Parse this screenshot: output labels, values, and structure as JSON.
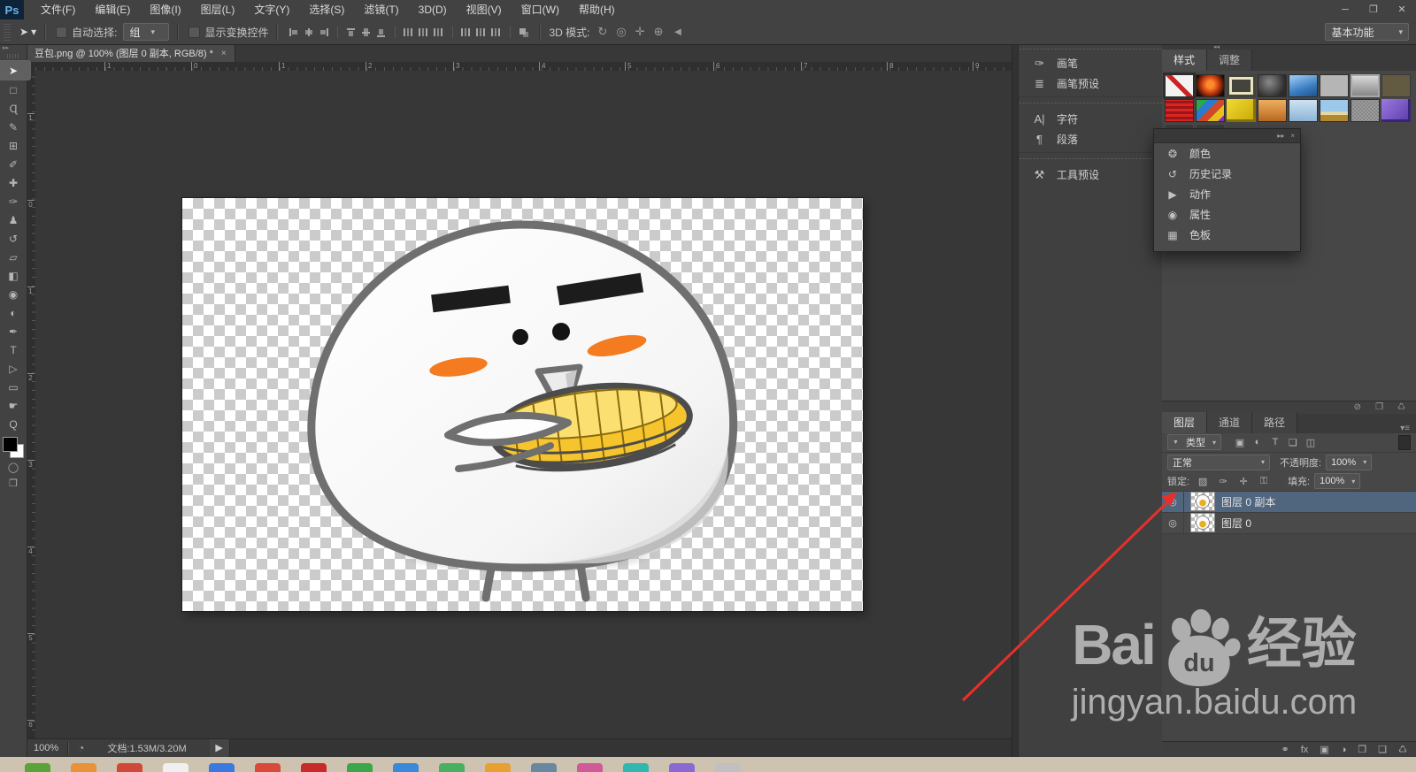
{
  "ui": {
    "caret": "▾",
    "collapse_right": "▸▸",
    "collapse_left": "◂◂",
    "panel_close": "×",
    "eye": "◎",
    "clock": "◔",
    "tab_menu": "▾≡"
  },
  "window": {
    "minimize": "─",
    "restore": "❐",
    "close": "✕"
  },
  "menubar": {
    "logo": "Ps",
    "items": [
      "文件(F)",
      "编辑(E)",
      "图像(I)",
      "图层(L)",
      "文字(Y)",
      "选择(S)",
      "滤镜(T)",
      "3D(D)",
      "视图(V)",
      "窗口(W)",
      "帮助(H)"
    ]
  },
  "optionsbar": {
    "tool_glyph": "➤",
    "auto_select_label": "自动选择:",
    "auto_select_value": "组",
    "show_transform_label": "显示变换控件",
    "align_icons": [
      {
        "n": "align-left-edges",
        "cls": "aln aln-l"
      },
      {
        "n": "align-horizontal-centers",
        "cls": "aln aln-cv"
      },
      {
        "n": "align-right-edges",
        "cls": "aln aln-r"
      },
      {
        "n": "align-top-edges",
        "cls": "aln aln-t gsp"
      },
      {
        "n": "align-vertical-centers",
        "cls": "aln aln-ch"
      },
      {
        "n": "align-bottom-edges",
        "cls": "aln aln-b"
      },
      {
        "n": "distribute-top-edges",
        "cls": "aln aln-d gsp"
      },
      {
        "n": "distribute-vertical-centers",
        "cls": "aln aln-d"
      },
      {
        "n": "distribute-bottom-edges",
        "cls": "aln aln-d"
      },
      {
        "n": "distribute-left-edges",
        "cls": "aln aln-d gsp"
      },
      {
        "n": "distribute-horizontal-centers",
        "cls": "aln aln-d"
      },
      {
        "n": "distribute-right-edges",
        "cls": "aln aln-d"
      },
      {
        "n": "auto-align-layers",
        "cls": "aln aln-x gsp"
      }
    ],
    "mode_label": "3D 模式:",
    "mode_icons": [
      {
        "g": "↻",
        "n": "3d-rotate-icon"
      },
      {
        "g": "◎",
        "n": "3d-roll-icon"
      },
      {
        "g": "✛",
        "n": "3d-drag-icon"
      },
      {
        "g": "⊕",
        "n": "3d-slide-icon"
      },
      {
        "g": "◄",
        "n": "3d-scale-icon"
      }
    ],
    "workspace": "基本功能"
  },
  "doc": {
    "tab_title": "豆包.png @ 100% (图层 0 副本, RGB/8) *",
    "close": "×",
    "ruler_h": [
      {
        "t": "1",
        "css": "left:78px"
      },
      {
        "t": "0",
        "css": "left:176px"
      },
      {
        "t": "1",
        "css": "left:275px"
      },
      {
        "t": "2",
        "css": "left:373px"
      },
      {
        "t": "3",
        "css": "left:472px"
      },
      {
        "t": "4",
        "css": "left:569px"
      },
      {
        "t": "5",
        "css": "left:666px"
      },
      {
        "t": "6",
        "css": "left:766px"
      },
      {
        "t": "7",
        "css": "left:865px"
      },
      {
        "t": "8",
        "css": "left:962px"
      },
      {
        "t": "9",
        "css": "left:1059px"
      }
    ],
    "ruler_v": [
      {
        "t": "1",
        "css": "top:48px"
      },
      {
        "t": "0",
        "css": "top:146px"
      },
      {
        "t": "1",
        "css": "top:244px"
      },
      {
        "t": "2",
        "css": "top:342px"
      },
      {
        "t": "3",
        "css": "top:440px"
      },
      {
        "t": "4",
        "css": "top:538px"
      },
      {
        "t": "5",
        "css": "top:636px"
      },
      {
        "t": "6",
        "css": "top:734px"
      }
    ]
  },
  "tools": [
    {
      "g": "➤",
      "n": "move-tool",
      "cls": "tool sel"
    },
    {
      "g": "□",
      "n": "rectangular-marquee-tool",
      "cls": "tool"
    },
    {
      "g": "Ɋ",
      "n": "lasso-tool",
      "cls": "tool"
    },
    {
      "g": "✎",
      "n": "quick-selection-tool",
      "cls": "tool"
    },
    {
      "g": "⊞",
      "n": "crop-tool",
      "cls": "tool"
    },
    {
      "g": "✐",
      "n": "eyedropper-tool",
      "cls": "tool"
    },
    {
      "g": "✚",
      "n": "healing-brush-tool",
      "cls": "tool"
    },
    {
      "g": "✑",
      "n": "brush-tool",
      "cls": "tool"
    },
    {
      "g": "♟",
      "n": "clone-stamp-tool",
      "cls": "tool"
    },
    {
      "g": "↺",
      "n": "history-brush-tool",
      "cls": "tool"
    },
    {
      "g": "▱",
      "n": "eraser-tool",
      "cls": "tool"
    },
    {
      "g": "◧",
      "n": "gradient-tool",
      "cls": "tool"
    },
    {
      "g": "◉",
      "n": "blur-tool",
      "cls": "tool"
    },
    {
      "g": "◐",
      "n": "dodge-tool",
      "cls": "tool"
    },
    {
      "g": "✒",
      "n": "pen-tool",
      "cls": "tool"
    },
    {
      "g": "T",
      "n": "type-tool",
      "cls": "tool"
    },
    {
      "g": "▷",
      "n": "path-selection-tool",
      "cls": "tool"
    },
    {
      "g": "▭",
      "n": "rectangle-tool",
      "cls": "tool"
    },
    {
      "g": "☛",
      "n": "hand-tool",
      "cls": "tool"
    },
    {
      "g": "Ԛ",
      "n": "zoom-tool",
      "cls": "tool"
    }
  ],
  "dock": {
    "group1": [
      {
        "g": "✑",
        "label": "画笔"
      },
      {
        "g": "≣",
        "label": "画笔预设"
      }
    ],
    "group2": [
      {
        "g": "A|",
        "label": "字符"
      },
      {
        "g": "¶",
        "label": "段落"
      }
    ],
    "group3": [
      {
        "g": "⚒",
        "label": "工具预设"
      }
    ]
  },
  "floatpanel": {
    "items": [
      {
        "g": "❂",
        "label": "颜色"
      },
      {
        "g": "↺",
        "label": "历史记录"
      },
      {
        "g": "▶",
        "label": "动作"
      },
      {
        "g": "◉",
        "label": "属性"
      },
      {
        "g": "▦",
        "label": "色板"
      }
    ]
  },
  "styles_panel": {
    "tabs": [
      "样式",
      "调整"
    ],
    "swatches": [
      {
        "n": "style-none",
        "css": "background:linear-gradient(45deg,transparent 44%,#cc2222 44% 56%,transparent 56%),#f2f2f2;box-shadow:inset 0 0 0 1px #2d2d2d,0 0 0 2px #2e2e2e"
      },
      {
        "n": "style-orange-glow",
        "css": "background:radial-gradient(circle at 50% 45%,#ff8a2a 0 18%,#c63a10 45%,#1a0a06 78%)"
      },
      {
        "n": "style-cream-ring",
        "css": "background:#44443c;box-shadow:inset 0 0 0 3px #44443c,inset 0 0 0 6px #e9e4bd"
      },
      {
        "n": "style-dark-glass",
        "css": "background:radial-gradient(circle at 40% 35%,#8a8a8a,#2c2c2c 70%)"
      },
      {
        "n": "style-blue-gloss",
        "css": "background:linear-gradient(160deg,#8ec0ee 15%,#3a7cc0 60%,#1d4f86)"
      },
      {
        "n": "style-flat-gray",
        "css": "background:#b5b5b5"
      },
      {
        "n": "style-gray-bevel",
        "css": "background:linear-gradient(#e0e0e0,#7f7f7f);box-shadow:inset 0 0 0 2px #a8a8a8"
      },
      {
        "n": "style-olive",
        "css": "background:#7d6f3f;opacity:.5"
      },
      {
        "n": "style-red-stripes",
        "css": "background:repeating-linear-gradient(0deg,#d92626 0 3px,#9e1515 3px 6px)"
      },
      {
        "n": "style-multicolor",
        "css": "background:linear-gradient(135deg,#2aa84a 0 25%,#2a7ad0 25% 45%,#d04a2a 45% 65%,#e8c020 65% 85%,#8a2ad0 85%)"
      },
      {
        "n": "style-yellow-3d",
        "css": "background:linear-gradient(135deg,#f2da30,#c8a80a);box-shadow:inset -3px -3px 0 #8a7400"
      },
      {
        "n": "style-orange-gradient",
        "css": "background:linear-gradient(#f0b060,#b86820)"
      },
      {
        "n": "style-light-blue",
        "css": "background:linear-gradient(#cfe4f4,#8cb4d4)"
      },
      {
        "n": "style-landscape",
        "css": "background:linear-gradient(#9cc8ea 55%,#e8d8a0 55% 70%,#b08830 70%)"
      },
      {
        "n": "style-noise",
        "css": "background:repeating-conic-gradient(#9e9e9e 0 25%,#858585 0 50%) 0 0/4px 4px"
      },
      {
        "n": "style-purple-3d",
        "css": "background:linear-gradient(135deg,#9a7ae0,#5a3aa8);box-shadow:inset -3px -3px 0 #3a2478"
      },
      {
        "n": "style-empty-slot",
        "css": "background:#3d3d3d;box-shadow:inset 0 0 0 1px #4e4e4e"
      },
      {
        "n": "style-empty-slot",
        "css": "background:#3d3d3d;box-shadow:inset 0 0 0 1px #4e4e4e"
      }
    ],
    "footer_icons": [
      {
        "g": "⊘",
        "n": "clear-style-icon"
      },
      {
        "g": "❐",
        "n": "new-style-icon"
      },
      {
        "g": "♺",
        "n": "delete-style-icon"
      }
    ]
  },
  "layers_panel": {
    "tabs": [
      "图层",
      "通道",
      "路径"
    ],
    "filter_icon": "▼",
    "filter_value": "类型",
    "filter_icons": [
      {
        "g": "▣",
        "n": "filter-pixel-layers-icon"
      },
      {
        "g": "◐",
        "n": "filter-adjustment-layers-icon"
      },
      {
        "g": "T",
        "n": "filter-type-layers-icon"
      },
      {
        "g": "❏",
        "n": "filter-shape-layers-icon"
      },
      {
        "g": "◫",
        "n": "filter-smart-objects-icon"
      }
    ],
    "blend_mode": "正常",
    "opacity_label": "不透明度:",
    "opacity_value": "100%",
    "lock_label": "锁定:",
    "lock_icons": [
      {
        "g": "▨",
        "n": "lock-transparent-pixels-icon"
      },
      {
        "g": "✑",
        "n": "lock-image-pixels-icon"
      },
      {
        "g": "✛",
        "n": "lock-position-icon"
      },
      {
        "g": "⚿",
        "n": "lock-all-icon"
      }
    ],
    "fill_label": "填充:",
    "fill_value": "100%",
    "rows": [
      {
        "name": "图层 0 副本",
        "cls": "layer-row selected"
      },
      {
        "name": "图层 0",
        "cls": "layer-row"
      }
    ],
    "footer_icons": [
      {
        "g": "⚭",
        "n": "link-layers-icon"
      },
      {
        "g": "fx",
        "n": "layer-style-icon"
      },
      {
        "g": "▣",
        "n": "add-layer-mask-icon"
      },
      {
        "g": "◑",
        "n": "adjustment-layer-icon"
      },
      {
        "g": "❒",
        "n": "new-group-icon"
      },
      {
        "g": "❑",
        "n": "new-layer-icon"
      },
      {
        "g": "♺",
        "n": "delete-layer-icon"
      }
    ]
  },
  "statusbar": {
    "zoom": "100%",
    "doc_info": "文档:1.53M/3.20M",
    "arrow": "▶"
  },
  "watermark": {
    "bai": "Bai",
    "du": "du",
    "jingyan": "经验",
    "url": "jingyan.baidu.com"
  },
  "taskbar": {
    "icons": [
      {
        "css": "background:#5aa23a"
      },
      {
        "css": "background:#e8923a"
      },
      {
        "css": "background:#d04838"
      },
      {
        "css": "background:#f0f0f0"
      },
      {
        "css": "background:#3a7ade"
      },
      {
        "css": "background:#d94a3a"
      },
      {
        "css": "background:#c82a2a"
      },
      {
        "css": "background:#3aa84a"
      },
      {
        "css": "background:#3a88d8"
      },
      {
        "css": "background:#48b060"
      },
      {
        "css": "background:#e8a030"
      },
      {
        "css": "background:#6888a0"
      },
      {
        "css": "background:#d05a98"
      },
      {
        "css": "background:#30b8b0"
      },
      {
        "css": "background:#8a6ad0"
      },
      {
        "css": "background:#c0c0c0"
      }
    ]
  }
}
